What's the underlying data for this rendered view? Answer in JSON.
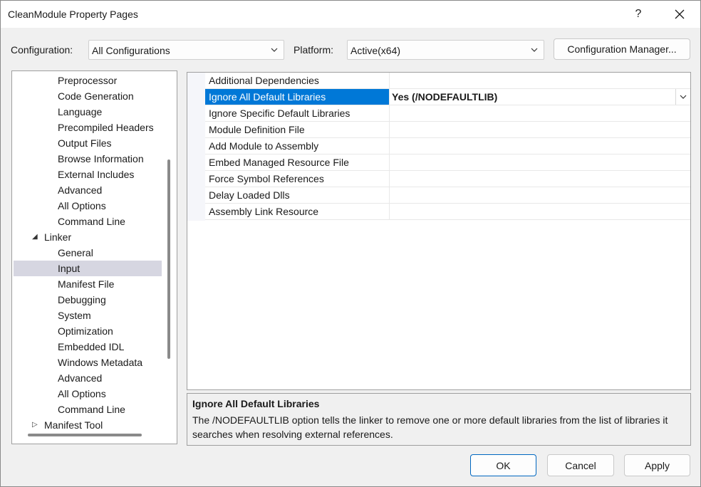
{
  "window": {
    "title": "CleanModule Property Pages",
    "help_label": "?",
    "close_label": "✕"
  },
  "config": {
    "configuration_label": "Configuration:",
    "configuration_value": "All Configurations",
    "platform_label": "Platform:",
    "platform_value": "Active(x64)",
    "manager_button": "Configuration Manager..."
  },
  "tree": {
    "items": [
      {
        "label": "Preprocessor",
        "level": 2
      },
      {
        "label": "Code Generation",
        "level": 2
      },
      {
        "label": "Language",
        "level": 2
      },
      {
        "label": "Precompiled Headers",
        "level": 2
      },
      {
        "label": "Output Files",
        "level": 2
      },
      {
        "label": "Browse Information",
        "level": 2
      },
      {
        "label": "External Includes",
        "level": 2
      },
      {
        "label": "Advanced",
        "level": 2
      },
      {
        "label": "All Options",
        "level": 2
      },
      {
        "label": "Command Line",
        "level": 2
      },
      {
        "label": "Linker",
        "level": 1,
        "expanded": true
      },
      {
        "label": "General",
        "level": 2
      },
      {
        "label": "Input",
        "level": 2,
        "selected": true
      },
      {
        "label": "Manifest File",
        "level": 2
      },
      {
        "label": "Debugging",
        "level": 2
      },
      {
        "label": "System",
        "level": 2
      },
      {
        "label": "Optimization",
        "level": 2
      },
      {
        "label": "Embedded IDL",
        "level": 2
      },
      {
        "label": "Windows Metadata",
        "level": 2
      },
      {
        "label": "Advanced",
        "level": 2
      },
      {
        "label": "All Options",
        "level": 2
      },
      {
        "label": "Command Line",
        "level": 2
      },
      {
        "label": "Manifest Tool",
        "level": 1,
        "expanded": false
      }
    ]
  },
  "properties": [
    {
      "name": "Additional Dependencies",
      "value": ""
    },
    {
      "name": "Ignore All Default Libraries",
      "value": "Yes (/NODEFAULTLIB)",
      "selected": true
    },
    {
      "name": "Ignore Specific Default Libraries",
      "value": ""
    },
    {
      "name": "Module Definition File",
      "value": ""
    },
    {
      "name": "Add Module to Assembly",
      "value": ""
    },
    {
      "name": "Embed Managed Resource File",
      "value": ""
    },
    {
      "name": "Force Symbol References",
      "value": ""
    },
    {
      "name": "Delay Loaded Dlls",
      "value": ""
    },
    {
      "name": "Assembly Link Resource",
      "value": ""
    }
  ],
  "description": {
    "title": "Ignore All Default Libraries",
    "text": "The /NODEFAULTLIB option tells the linker to remove one or more default libraries from the list of libraries it searches when resolving external references."
  },
  "buttons": {
    "ok": "OK",
    "cancel": "Cancel",
    "apply": "Apply"
  },
  "colors": {
    "selection": "#0078d7",
    "tree_selection": "#d6d6e1"
  }
}
